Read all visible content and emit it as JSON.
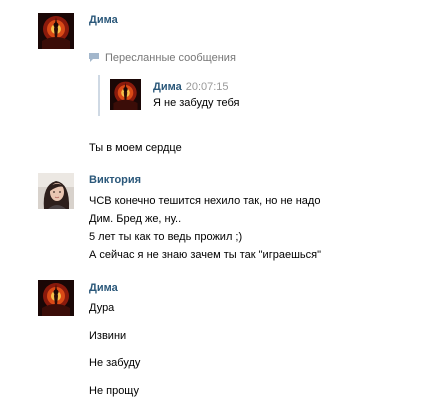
{
  "messages": [
    {
      "author": "Дима",
      "forwarded_header": "Пересланные сообщения",
      "forwarded": {
        "author": "Дима",
        "time": "20:07:15",
        "text": "Я не забуду тебя"
      },
      "lines": [
        "Ты в моем сердце"
      ]
    },
    {
      "author": "Виктория",
      "lines": [
        "ЧСВ конечно тешится нехило так, но не надо",
        "Дим. Бред же, ну..",
        "5 лет ты как то ведь прожил ;)",
        "А сейчас я не знаю зачем ты так \"играешься\""
      ]
    },
    {
      "author": "Дима",
      "lines": [
        "Дура",
        "Извини",
        "Не забуду",
        "Не прощу"
      ]
    }
  ],
  "icons": {
    "dima_avatar": "dark-red-portrait",
    "viktoria_avatar": "girl-photo",
    "forward": "speech-bubble-icon"
  },
  "colors": {
    "author": "#2b587a",
    "muted": "#777777",
    "time": "#999999",
    "forward_bar": "#cfd9e4"
  }
}
